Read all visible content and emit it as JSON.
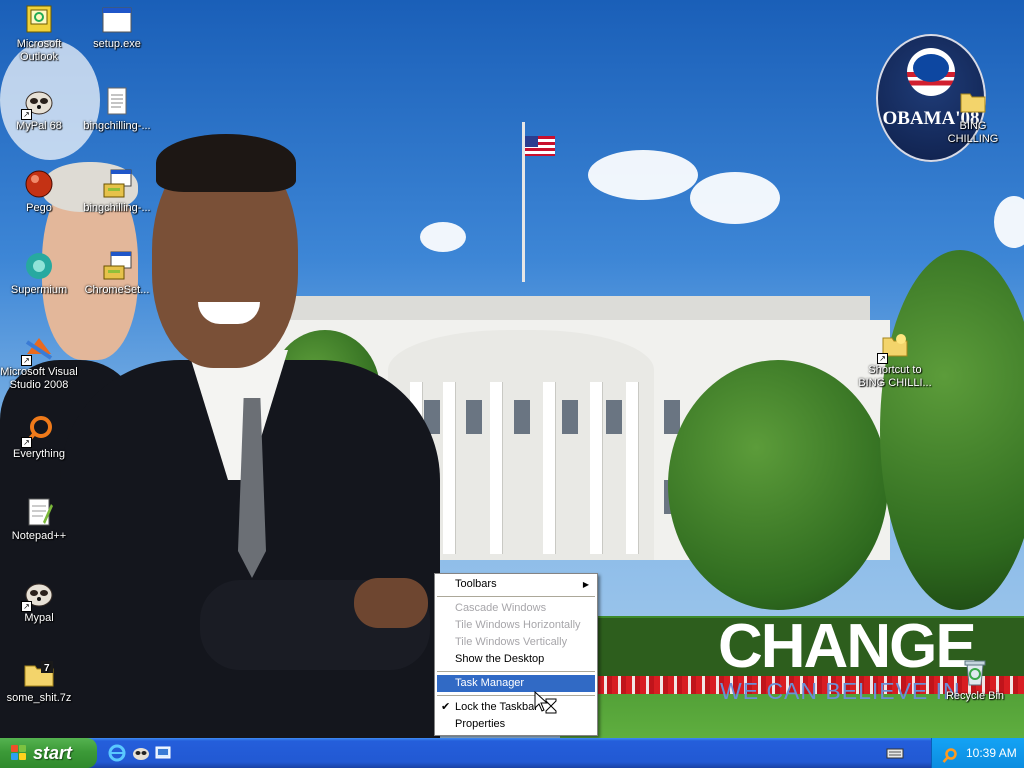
{
  "desktop_icons": [
    {
      "name": "icon-microsoft-outlook",
      "label": "Microsoft Outlook",
      "pic": "outlook-icon"
    },
    {
      "name": "icon-setup-exe",
      "label": "setup.exe",
      "pic": "window-app-icon"
    },
    {
      "name": "icon-mypal-68",
      "label": "MyPal 68",
      "pic": "mypal-raccoon-icon"
    },
    {
      "name": "icon-bingchilling-1",
      "label": "bingchilling-...",
      "pic": "document-icon"
    },
    {
      "name": "icon-pego",
      "label": "Pego",
      "pic": "pego-ball-icon"
    },
    {
      "name": "icon-bingchilling-2",
      "label": "bingchilling-...",
      "pic": "installer-icon"
    },
    {
      "name": "icon-supermium",
      "label": "Supermium",
      "pic": "supermium-icon"
    },
    {
      "name": "icon-chromeset",
      "label": "ChromeSet...",
      "pic": "installer-icon"
    },
    {
      "name": "icon-visual-studio-2008",
      "label": "Microsoft Visual Studio 2008",
      "pic": "visual-studio-icon"
    },
    {
      "name": "icon-everything",
      "label": "Everything",
      "pic": "everything-search-icon"
    },
    {
      "name": "icon-notepad-plus-plus",
      "label": "Notepad++",
      "pic": "notepad-plus-plus-icon"
    },
    {
      "name": "icon-mypal",
      "label": "Mypal",
      "pic": "mypal-raccoon-icon"
    },
    {
      "name": "icon-some-shit-7z",
      "label": "some_shit.7z",
      "pic": "7zip-archive-icon"
    },
    {
      "name": "icon-bing-chilling-folder",
      "label": "BING CHILLING",
      "pic": "folder-icon"
    },
    {
      "name": "icon-shortcut-bing-chilling",
      "label": "Shortcut to BING CHILLI...",
      "pic": "folder-shortcut-icon"
    },
    {
      "name": "icon-recycle-bin",
      "label": "Recycle Bin",
      "pic": "recycle-bin-icon"
    }
  ],
  "wallpaper": {
    "slogan_big": "CHANGE",
    "slogan_small": "WE CAN BELIEVE IN",
    "logo_text": "OBAMA'08"
  },
  "context_menu": {
    "items": [
      {
        "label": "Toolbars",
        "submenu": true,
        "enabled": true
      },
      {
        "label": "Cascade Windows",
        "enabled": false
      },
      {
        "label": "Tile Windows Horizontally",
        "enabled": false
      },
      {
        "label": "Tile Windows Vertically",
        "enabled": false
      },
      {
        "label": "Show the Desktop",
        "enabled": true
      },
      {
        "label": "Task Manager",
        "enabled": true,
        "highlighted": true
      },
      {
        "label": "Lock the Taskbar",
        "enabled": true,
        "checked": true
      },
      {
        "label": "Properties",
        "enabled": true
      }
    ],
    "submenu_arrow": "▶",
    "check_mark": "✔"
  },
  "taskbar": {
    "start_label": "start",
    "quick_launch": [
      "internet-explorer-icon",
      "mypal-raccoon-icon",
      "show-desktop-icon"
    ],
    "tray_icons": [
      "keyboard-icon",
      "search-icon"
    ],
    "clock": "10:39 AM"
  },
  "colors": {
    "taskbar_blue": "#245edb",
    "start_green": "#3c9a38",
    "menu_highlight": "#316ac5",
    "tray_blue": "#0c8de0"
  }
}
